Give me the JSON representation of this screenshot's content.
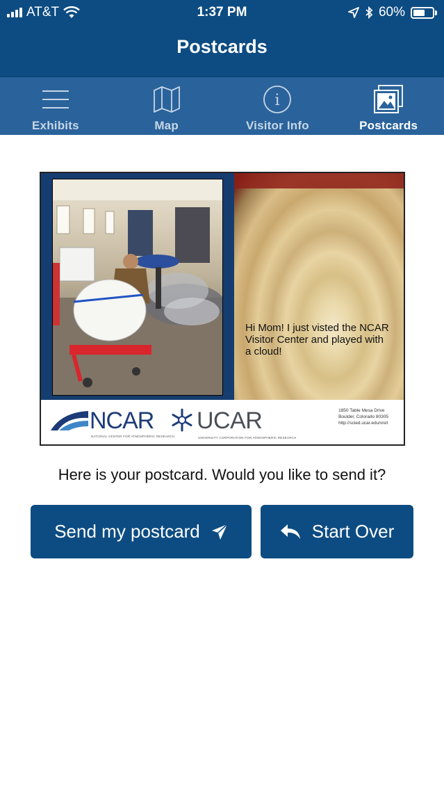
{
  "status_bar": {
    "carrier": "AT&T",
    "time": "1:37 PM",
    "battery_percent": "60%",
    "battery_level": 0.6
  },
  "nav": {
    "title": "Postcards"
  },
  "tabs": [
    {
      "label": "Exhibits",
      "icon": "menu-icon",
      "active": false
    },
    {
      "label": "Map",
      "icon": "map-icon",
      "active": false
    },
    {
      "label": "Visitor Info",
      "icon": "info-icon",
      "active": false
    },
    {
      "label": "Postcards",
      "icon": "postcards-icon",
      "active": true
    }
  ],
  "postcard": {
    "message": "Hi Mom! I just visted the NCAR Visitor Center and played with a cloud!",
    "logo_ncar": "NCAR",
    "logo_ncar_sub": "NATIONAL CENTER FOR ATMOSPHERIC RESEARCH",
    "logo_ucar": "UCAR",
    "logo_ucar_sub": "UNIVERSITY CORPORATION FOR ATMOSPHERIC RESEARCH",
    "address_line1": "1850 Table Mesa Drive",
    "address_line2": "Boulder, Colorado 80305",
    "address_line3": "http://scied.ucar.edu/visit"
  },
  "prompt": "Here is your postcard. Would you like to send it?",
  "buttons": {
    "send": "Send my postcard",
    "start_over": "Start Over"
  },
  "colors": {
    "header": "#0d4c82",
    "tabbar": "#2a639b",
    "button": "#0d4c82"
  }
}
